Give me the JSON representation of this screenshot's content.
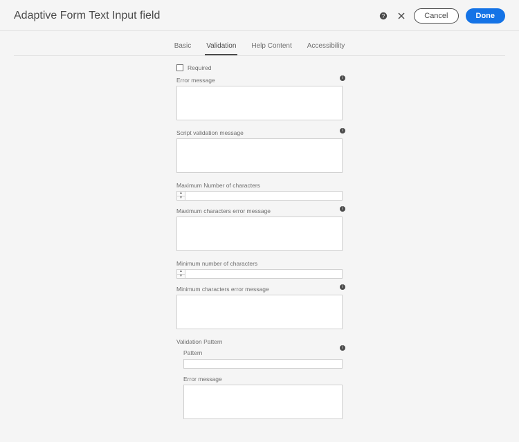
{
  "header": {
    "title": "Adaptive Form Text Input field",
    "cancel": "Cancel",
    "done": "Done"
  },
  "tabs": {
    "basic": "Basic",
    "validation": "Validation",
    "help": "Help Content",
    "accessibility": "Accessibility"
  },
  "form": {
    "required": "Required",
    "error_message": "Error message",
    "script_validation": "Script validation message",
    "max_chars": "Maximum Number of characters",
    "max_chars_error": "Maximum characters error message",
    "min_chars": "Minimum number of characters",
    "min_chars_error": "Minimum characters error message",
    "validation_pattern": "Validation Pattern",
    "pattern": "Pattern",
    "pattern_error": "Error message"
  }
}
